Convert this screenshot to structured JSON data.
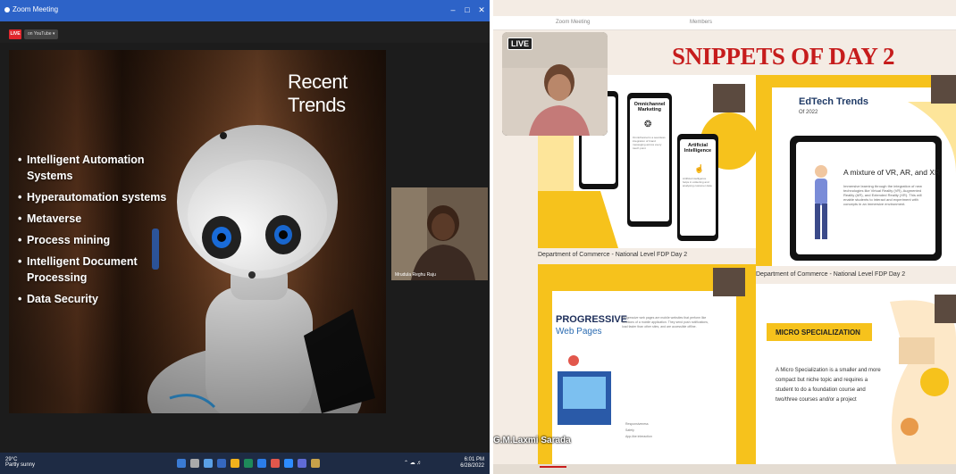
{
  "zoom": {
    "title": "Zoom Meeting",
    "live_badge": "LIVE",
    "youtube_label": "on YouTube",
    "slide": {
      "title": "Recent Trends",
      "bullets": [
        "Intelligent Automation Systems",
        "Hyperautomation systems",
        "Metaverse",
        "Process mining",
        "Intelligent Document Processing",
        "Data Security"
      ]
    },
    "participant_tile": {
      "name": "Mrudula Reghu Raju"
    },
    "taskbar": {
      "weather": "29°C",
      "weather_sub": "Partly sunny",
      "time": "6:01 PM",
      "date": "6/28/2022"
    }
  },
  "collage": {
    "topbar": {
      "left": "Zoom Meeting",
      "right": "Members"
    },
    "headline": "SNIPPETS OF DAY 2",
    "live_label": "LIVE",
    "edtech": {
      "title": "EdTech Trends",
      "subtitle": "Of 2022",
      "tablet_heading": "A mixture of VR, AR, and XR",
      "tablet_text": "Immersive learning through the integration of new technologies like Virtual Reality (VR), Augmented Reality (AR), and Extended Reality (XR). This will enable students to interact and experiment with concepts in an immersive environment."
    },
    "phones": [
      {
        "title": "Omnichannel Marketing",
        "text": "Omnichannel is a seamless integration of brand messaging across every touch point"
      },
      {
        "title": "Artificial Intelligence",
        "text": "Artificial intelligence helps in collecting and analysing customer data"
      }
    ],
    "footer_a": "Department of Commerce - National Level FDP Day 2",
    "footer_b": "Department of Commerce - National Level FDP Day 2",
    "pwa": {
      "title": "PROGRESSIVE",
      "subtitle": "Web Pages",
      "text": "Progressive web pages are mobile websites that perform like functions of a mobile application. They send push notifications, load faster than other sites, and are accessible offline.",
      "list": [
        "Responsiveness",
        "Safety",
        "App-like interaction"
      ]
    },
    "micro": {
      "title": "MICRO SPECIALIZATION",
      "text": "A Micro Specialization is a smaller and more compact but niche topic and requires a student to do a foundation course and two/three courses and/or a project"
    },
    "speaker_caption": "G.M.Laxmi Sarada"
  }
}
